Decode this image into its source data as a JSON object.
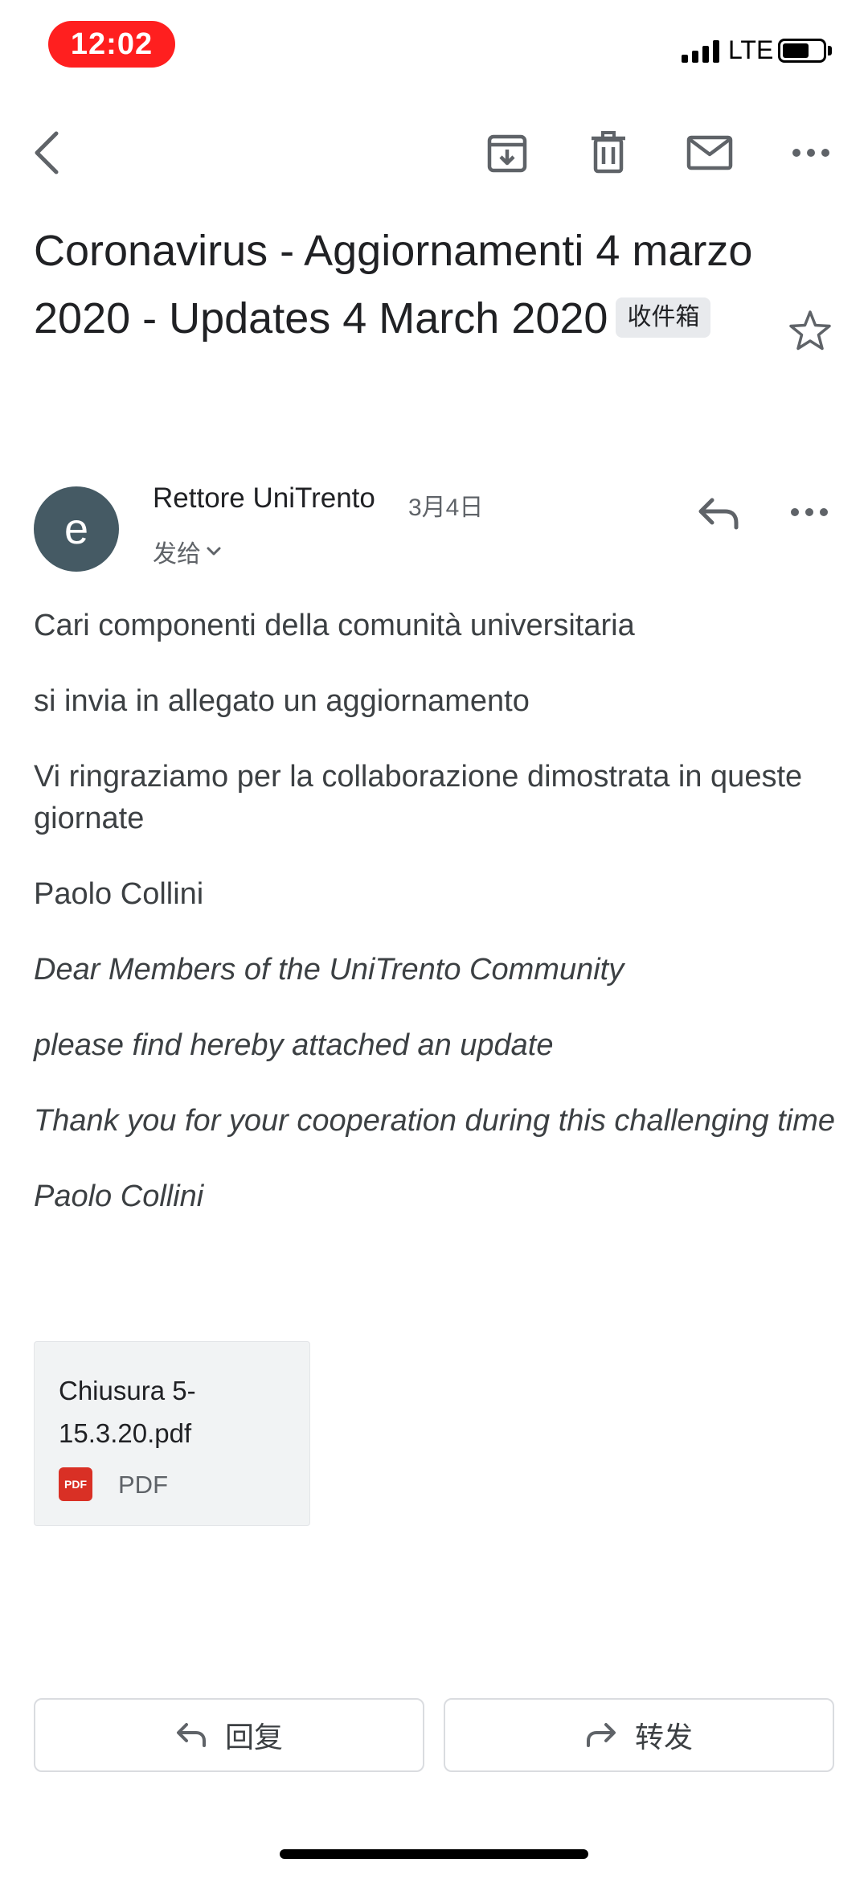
{
  "status_bar": {
    "time": "12:02",
    "network": "LTE"
  },
  "email": {
    "subject": "Coronavirus - Aggiornamenti 4 marzo 2020 - Updates 4 March 2020",
    "label": "收件箱",
    "sender": {
      "avatar_letter": "e",
      "avatar_color": "#455a64",
      "name": "Rettore UniTrento",
      "date": "3月4日",
      "recipient_label": "发给"
    },
    "body": {
      "p1": "Cari componenti della comunità universitaria",
      "p2": "si invia in allegato un aggiornamento",
      "p3": "Vi ringraziamo per la collaborazione dimostrata in queste giornate",
      "p4": "Paolo Collini",
      "p5": "Dear Members of the UniTrento Community",
      "p6": "please find hereby attached an update",
      "p7": "Thank you for your cooperation during this challenging time",
      "p8": "Paolo Collini"
    },
    "attachment": {
      "filename": "Chiusura 5-15.3.20.pdf",
      "badge": "PDF",
      "type": "PDF"
    }
  },
  "actions": {
    "reply_label": "回复",
    "forward_label": "转发"
  },
  "colors": {
    "time_pill": "#ff1f1f",
    "pdf_badge": "#d93025"
  }
}
